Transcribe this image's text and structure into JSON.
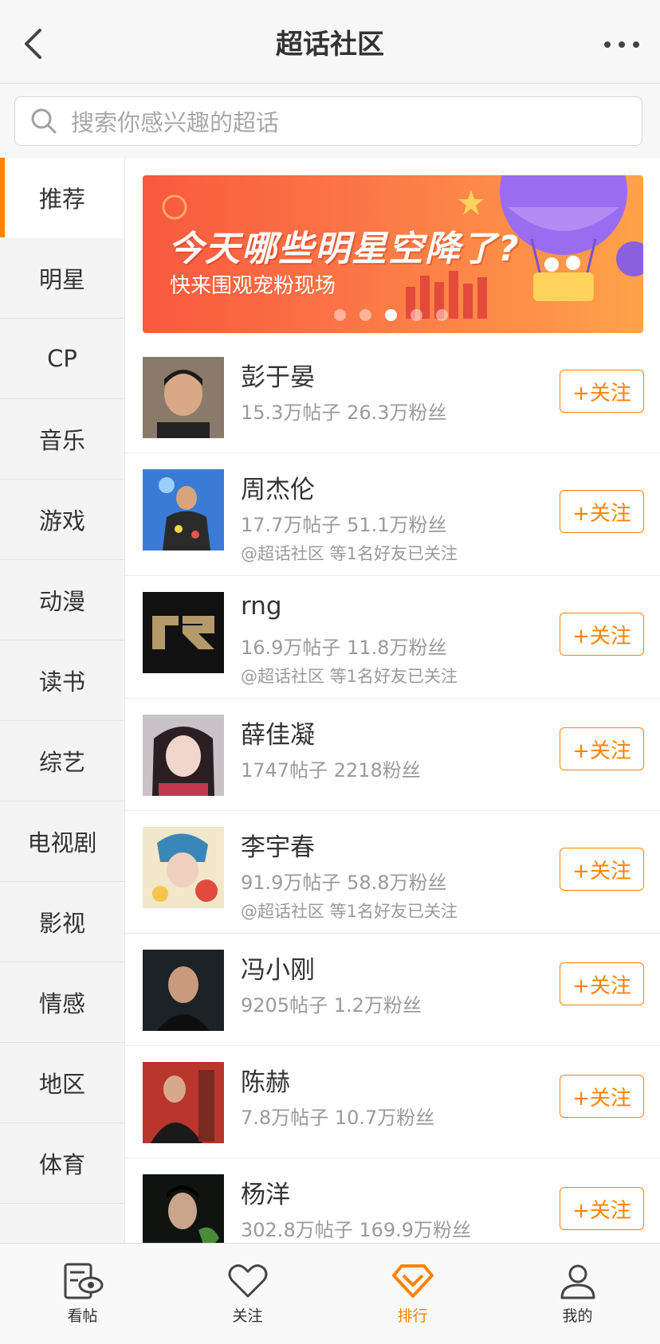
{
  "header": {
    "title": "超话社区"
  },
  "search": {
    "placeholder": "搜索你感兴趣的超话"
  },
  "sidebar": {
    "items": [
      {
        "label": "推荐",
        "active": true
      },
      {
        "label": "明星"
      },
      {
        "label": "CP"
      },
      {
        "label": "音乐"
      },
      {
        "label": "游戏"
      },
      {
        "label": "动漫"
      },
      {
        "label": "读书"
      },
      {
        "label": "综艺"
      },
      {
        "label": "电视剧"
      },
      {
        "label": "影视"
      },
      {
        "label": "情感"
      },
      {
        "label": "地区"
      },
      {
        "label": "体育"
      }
    ]
  },
  "banner": {
    "title": "今天哪些明星空降了?",
    "subtitle": "快来围观宠粉现场",
    "dot_count": 5,
    "active_dot": 2
  },
  "list": [
    {
      "name": "彭于晏",
      "stats": "15.3万帖子 26.3万粉丝",
      "friends": "",
      "follow_label": "+关注"
    },
    {
      "name": "周杰伦",
      "stats": "17.7万帖子 51.1万粉丝",
      "friends": "@超话社区 等1名好友已关注",
      "follow_label": "+关注"
    },
    {
      "name": "rng",
      "stats": "16.9万帖子 11.8万粉丝",
      "friends": "@超话社区 等1名好友已关注",
      "follow_label": "+关注"
    },
    {
      "name": "薛佳凝",
      "stats": "1747帖子 2218粉丝",
      "friends": "",
      "follow_label": "+关注"
    },
    {
      "name": "李宇春",
      "stats": "91.9万帖子 58.8万粉丝",
      "friends": "@超话社区 等1名好友已关注",
      "follow_label": "+关注"
    },
    {
      "name": "冯小刚",
      "stats": "9205帖子 1.2万粉丝",
      "friends": "",
      "follow_label": "+关注"
    },
    {
      "name": "陈赫",
      "stats": "7.8万帖子 10.7万粉丝",
      "friends": "",
      "follow_label": "+关注"
    },
    {
      "name": "杨洋",
      "stats": "302.8万帖子 169.9万粉丝",
      "friends": "",
      "follow_label": "+关注"
    }
  ],
  "tabbar": {
    "items": [
      {
        "label": "看帖",
        "icon": "read-post-icon"
      },
      {
        "label": "关注",
        "icon": "heart-icon"
      },
      {
        "label": "排行",
        "icon": "diamond-rank-icon",
        "active": true
      },
      {
        "label": "我的",
        "icon": "profile-icon"
      }
    ]
  },
  "colors": {
    "accent": "#ff8200",
    "banner_start": "#f9593f",
    "banner_end": "#ffa24a"
  }
}
